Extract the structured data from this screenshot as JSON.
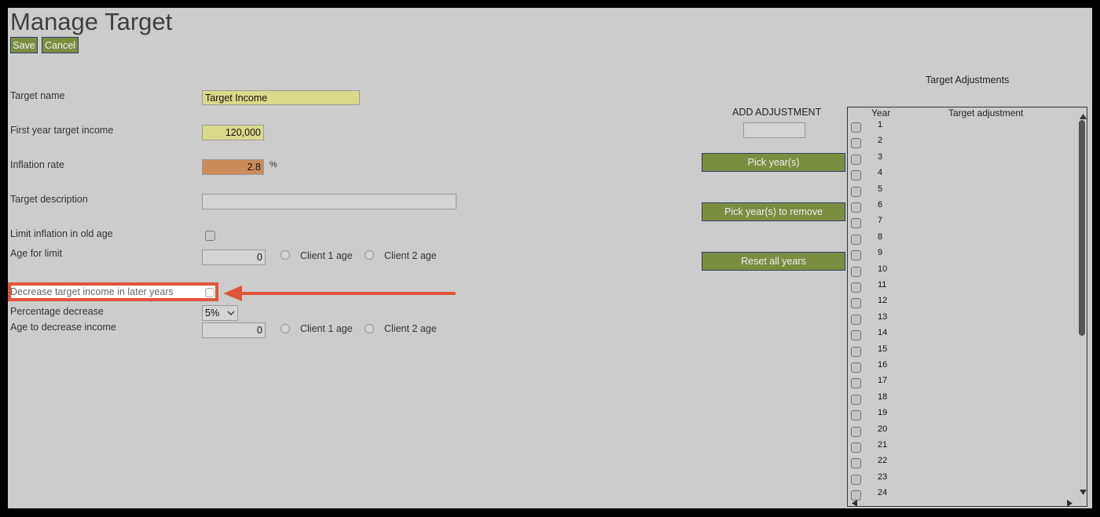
{
  "page": {
    "title": "Manage Target",
    "save_label": "Save",
    "cancel_label": "Cancel"
  },
  "form": {
    "target_name_label": "Target name",
    "target_name_value": "Target Income",
    "first_year_label": "First year target income",
    "first_year_value": "120,000",
    "inflation_label": "Inflation rate",
    "inflation_value": "2.8",
    "inflation_unit": "%",
    "description_label": "Target description",
    "description_value": "",
    "limit_inflation_label": "Limit inflation in old age",
    "age_limit_label": "Age for limit",
    "age_limit_value": "0",
    "client1_age_label": "Client 1 age",
    "client2_age_label": "Client 2 age",
    "decrease_label": "Decrease target income in later years",
    "percentage_decrease_label": "Percentage decrease",
    "percentage_decrease_value": "5%",
    "age_decrease_label": "Age to decrease income",
    "age_decrease_value": "0"
  },
  "adjustments": {
    "header": "Target Adjustments",
    "add_label": "ADD ADJUSTMENT",
    "add_value": "",
    "pick_years_label": "Pick year(s)",
    "pick_remove_label": "Pick year(s) to remove",
    "reset_label": "Reset all years",
    "col_year": "Year",
    "col_adjustment": "Target adjustment",
    "years": [
      "1",
      "2",
      "3",
      "4",
      "5",
      "6",
      "7",
      "8",
      "9",
      "10",
      "11",
      "12",
      "13",
      "14",
      "15",
      "16",
      "17",
      "18",
      "19",
      "20",
      "21",
      "22",
      "23",
      "24"
    ]
  },
  "annotation": {
    "color": "#e0553a"
  }
}
